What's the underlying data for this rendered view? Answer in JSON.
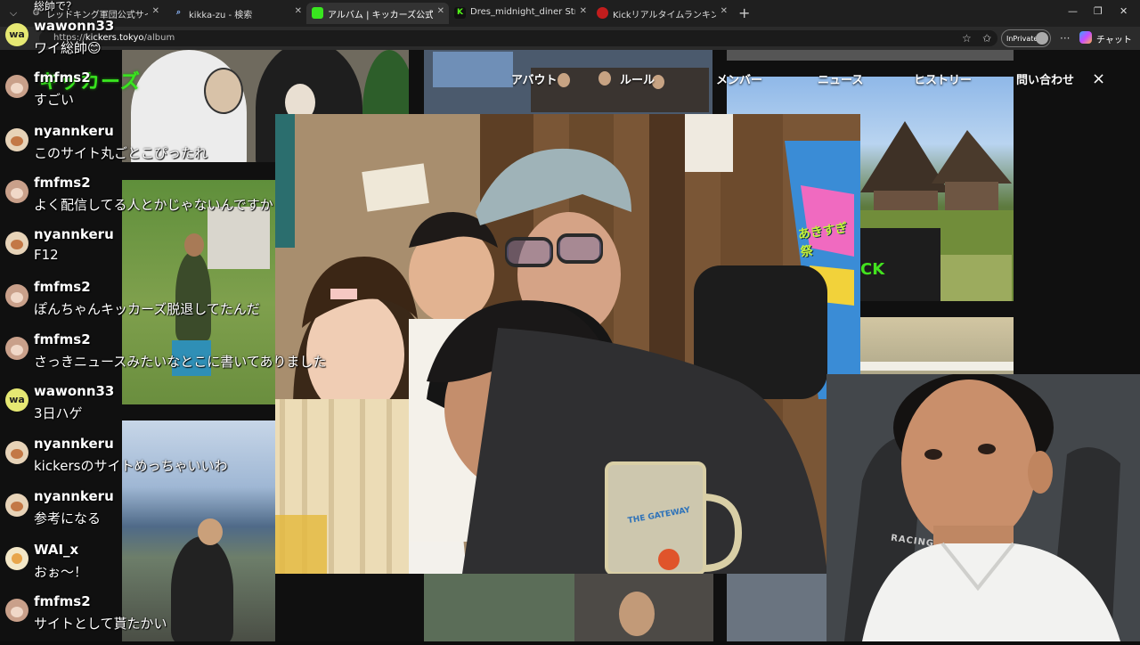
{
  "browser": {
    "tabs": [
      {
        "title": "レッドキング軍団公式サイト",
        "favicon": "globe-icon",
        "active": false
      },
      {
        "title": "kikka-zu - 検索",
        "favicon": "search-icon",
        "active": false
      },
      {
        "title": "アルバム | キッカーズ公式サイト",
        "favicon": "kickers-icon",
        "active": true
      },
      {
        "title": "Dres_midnight_diner Stream - Wat",
        "favicon": "kick-icon",
        "active": false
      },
      {
        "title": "Kickリアルタイムランキング | 配信者別",
        "favicon": "ranking-icon",
        "active": false
      }
    ],
    "url_host": "kickers.tokyo",
    "url_path": "/album",
    "url_prefix": "https://",
    "inprivate_label": "InPrivate",
    "chat_label": "チャット"
  },
  "site": {
    "logo": "キッカーズ",
    "nav": [
      "アバウト",
      "ルール",
      "メンバー",
      "ニュース",
      "ヒストリー",
      "問い合わせ"
    ],
    "close": "×"
  },
  "chat": {
    "top_fragment": "総帥で？",
    "messages": [
      {
        "user": "wawonn33",
        "text": "ワイ総帥😊",
        "avatar": "wa"
      },
      {
        "user": "fmfms2",
        "text": "すごい",
        "avatar": "fm"
      },
      {
        "user": "nyannkeru",
        "text": "このサイト丸ごとこぴったれ",
        "avatar": "ny"
      },
      {
        "user": "fmfms2",
        "text": "よく配信してる人とかじゃないんですか",
        "avatar": "fm"
      },
      {
        "user": "nyannkeru",
        "text": "F12",
        "avatar": "ny"
      },
      {
        "user": "fmfms2",
        "text": "ぽんちゃんキッカーズ脱退してたんだ",
        "avatar": "fm"
      },
      {
        "user": "fmfms2",
        "text": "さっきニュースみたいなとこに書いてありました",
        "avatar": "fm"
      },
      {
        "user": "wawonn33",
        "text": "3日ハゲ",
        "avatar": "wa"
      },
      {
        "user": "nyannkeru",
        "text": "kickersのサイトめっちゃいいわ",
        "avatar": "ny"
      },
      {
        "user": "nyannkeru",
        "text": "参考になる",
        "avatar": "ny"
      },
      {
        "user": "WAI_x",
        "text": "おぉ～！",
        "avatar": "wx"
      },
      {
        "user": "fmfms2",
        "text": "サイトとして貰たかい",
        "avatar": "fm"
      }
    ]
  },
  "photo_text": {
    "festival_sign": "あきすぎ祭",
    "shirt_print": "CK",
    "mug_logo": "THE GATEWAY"
  },
  "webcam": {
    "chair_text": "RACING"
  }
}
